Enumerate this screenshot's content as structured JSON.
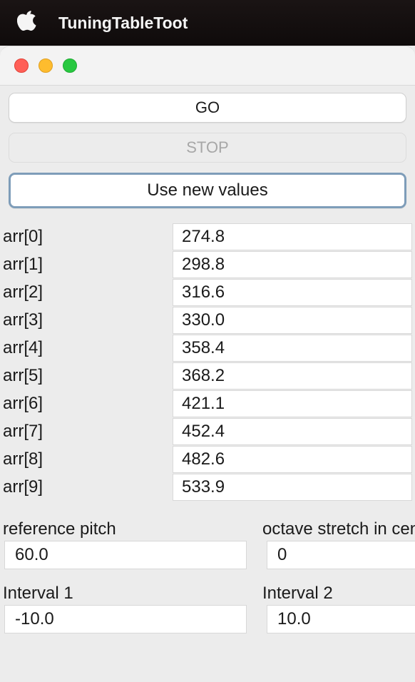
{
  "menubar": {
    "app_title": "TuningTableToot"
  },
  "buttons": {
    "go": "GO",
    "stop": "STOP",
    "use_new": "Use new values"
  },
  "arr": [
    {
      "label": "arr[0]",
      "value": "274.8"
    },
    {
      "label": "arr[1]",
      "value": "298.8"
    },
    {
      "label": "arr[2]",
      "value": "316.6"
    },
    {
      "label": "arr[3]",
      "value": "330.0"
    },
    {
      "label": "arr[4]",
      "value": "358.4"
    },
    {
      "label": "arr[5]",
      "value": "368.2"
    },
    {
      "label": "arr[6]",
      "value": "421.1"
    },
    {
      "label": "arr[7]",
      "value": "452.4"
    },
    {
      "label": "arr[8]",
      "value": "482.6"
    },
    {
      "label": "arr[9]",
      "value": "533.9"
    }
  ],
  "params": {
    "ref_pitch_label": "reference pitch",
    "ref_pitch_value": "60.0",
    "octave_stretch_label": "octave stretch in cents",
    "octave_stretch_value": "0",
    "interval1_label": "Interval 1",
    "interval1_value": "-10.0",
    "interval2_label": "Interval 2",
    "interval2_value": "10.0"
  }
}
